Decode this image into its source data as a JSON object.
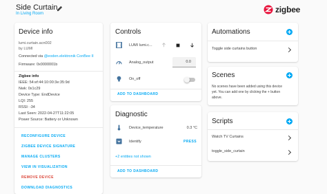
{
  "header": {
    "title": "Side Curtain",
    "area": "In Living Room",
    "brand": "zigbee"
  },
  "device_info": {
    "title": "Device info",
    "model": "lumi.curtain.acn002",
    "manufacturer": "by LUMI",
    "connected_prefix": "Connected via ",
    "connected_link": "@eoden.elektronik ConBee II",
    "firmware": "Firmware: 0x0000001b",
    "zigbee_title": "Zigbee info",
    "ieee": "IEEE: 54:ef:44:10:00:3e:35:9d",
    "nwk": "Nwk: 0x1c29",
    "device_type": "Device Type: EndDevice",
    "lqi": "LQI: 255",
    "rssi": "RSSI: -34",
    "last_seen": "Last Seen: 2022-04-27T11:22:05",
    "power_source": "Power Source: Battery or Unknown",
    "actions": [
      "RECONFIGURE DEVICE",
      "ZIGBEE DEVICE SIGNATURE",
      "MANAGE CLUSTERS",
      "VIEW IN VISUALIZATION",
      "REMOVE DEVICE",
      "DOWNLOAD DIAGNOSTICS"
    ]
  },
  "controls": {
    "title": "Controls",
    "cover_name": "LUMI lumi.c...",
    "analog_label": "Analog_output",
    "analog_value": "0.0",
    "onoff_label": "On_off",
    "add_to_dashboard": "ADD TO DASHBOARD"
  },
  "diagnostic": {
    "title": "Diagnostic",
    "temp_label": "Device_temperature",
    "temp_value": "0.3 °C",
    "identify_label": "Identify",
    "identify_action": "PRESS",
    "hidden_entities": "+2 entities not shown",
    "add_to_dashboard": "ADD TO DASHBOARD"
  },
  "automations": {
    "title": "Automations",
    "items": [
      "Toggle side curtains button"
    ]
  },
  "scenes": {
    "title": "Scenes",
    "empty_text_line1": "No scenes have been added using this device",
    "empty_text_line2": "yet. You can add one by clicking the + button",
    "empty_text_line3": "above."
  },
  "scripts": {
    "title": "Scripts",
    "items": [
      "Watch TV Curtains",
      "toggle_side_curtain"
    ]
  },
  "colors": {
    "accent": "#03a9f4",
    "danger": "#db4437",
    "icon": "#44739e"
  },
  "icons": [
    "pencil-icon",
    "zigbee-logo-icon",
    "curtain-icon",
    "arrow-up-icon",
    "stop-icon",
    "arrow-down-icon",
    "gauge-icon",
    "lightbulb-icon",
    "thermometer-icon",
    "identify-icon",
    "plus-icon",
    "chevron-right-icon"
  ]
}
